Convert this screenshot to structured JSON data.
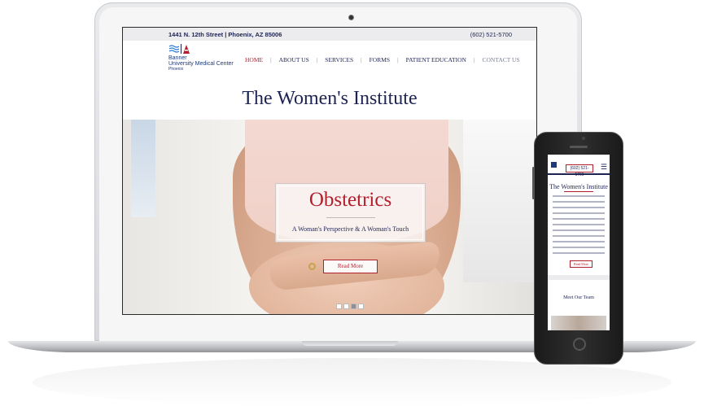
{
  "desktop": {
    "topbar": {
      "address": "1441 N. 12th Street | Phoenix, AZ 85006",
      "phone": "(602) 521-5700"
    },
    "logo": {
      "line1": "Banner",
      "line2": "University Medical Center",
      "line3": "Phoenix"
    },
    "nav": [
      {
        "label": "HOME",
        "active": true
      },
      {
        "label": "ABOUT US"
      },
      {
        "label": "SERVICES"
      },
      {
        "label": "FORMS"
      },
      {
        "label": "PATIENT EDUCATION"
      },
      {
        "label": "CONTACT US"
      }
    ],
    "separator": "|",
    "title": "The Women's Institute",
    "hero": {
      "heading": "Obstetrics",
      "subheading": "A Woman's Perspective & A Woman's Touch",
      "button_label": "Read More",
      "slides_total": 4,
      "active_slide": 3
    }
  },
  "mobile": {
    "header_phone": "(602) 521-5700",
    "menu_icon": "☰",
    "title": "The Women's Institute",
    "button_label": "Read More",
    "section_title": "Meet Our Team"
  },
  "colors": {
    "navy": "#1d2352",
    "accent_red": "#b21f2d"
  },
  "icons": [
    "logo-mark-icon",
    "hamburger-menu-icon"
  ]
}
